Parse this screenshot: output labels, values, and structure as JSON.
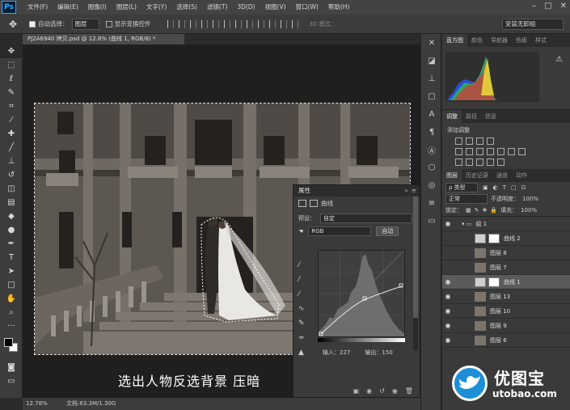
{
  "app": {
    "logo": "Ps"
  },
  "menu": [
    "文件(F)",
    "编辑(E)",
    "图像(I)",
    "图层(L)",
    "文字(Y)",
    "选择(S)",
    "滤镜(T)",
    "3D(D)",
    "视图(V)",
    "窗口(W)",
    "帮助(H)"
  ],
  "options": {
    "auto_select_label": "自动选择：",
    "auto_select_value": "图层",
    "show_transform_label": "显示变换控件",
    "mode_3d_label": "3D 模式：",
    "workspace": "安装无卸组"
  },
  "document": {
    "tab_title": "PJ2A6940 拷贝.psd @ 12.8% (曲线 1, RGB/8) *",
    "caption": "选出人物反选背景 压暗"
  },
  "status": {
    "zoom": "12.78%",
    "doc_info": "文档:63.3M/1.30G"
  },
  "properties": {
    "title": "属性",
    "collapse": "»",
    "menu": "≡",
    "adjustment_name": "曲线",
    "preset_label": "预设：",
    "preset_value": "自定",
    "channel_value": "RGB",
    "auto_label": "自动",
    "input_label": "输入：227",
    "output_label": "输出：150"
  },
  "right_panel": {
    "top_tabs": [
      "直方图",
      "颜色",
      "导航器",
      "色板",
      "样式"
    ],
    "adj_tabs": [
      "调整",
      "路径",
      "信息"
    ],
    "adj_title": "添加调整",
    "layer_tabs": [
      "图层",
      "历史记录",
      "通道",
      "动作"
    ],
    "filter_label": "ρ 类型",
    "blend_mode": "正常",
    "opacity_label": "不透明度：",
    "opacity_value": "100%",
    "lock_label": "锁定：",
    "fill_label": "填充：",
    "fill_value": "100%"
  },
  "layers": [
    {
      "name": "组 1",
      "visible": true,
      "type": "group"
    },
    {
      "name": "曲线 2",
      "visible": false,
      "type": "adjustment"
    },
    {
      "name": "图层 8",
      "visible": false,
      "type": "pixel"
    },
    {
      "name": "图层 7",
      "visible": false,
      "type": "pixel"
    },
    {
      "name": "曲线 1",
      "visible": true,
      "type": "adjustment",
      "selected": true
    },
    {
      "name": "图层 13",
      "visible": true,
      "type": "pixel"
    },
    {
      "name": "图层 10",
      "visible": true,
      "type": "pixel"
    },
    {
      "name": "图层 9",
      "visible": true,
      "type": "pixel"
    },
    {
      "name": "图层 6",
      "visible": true,
      "type": "pixel"
    }
  ],
  "watermark": {
    "title": "优图宝",
    "url": "utobao.com"
  }
}
